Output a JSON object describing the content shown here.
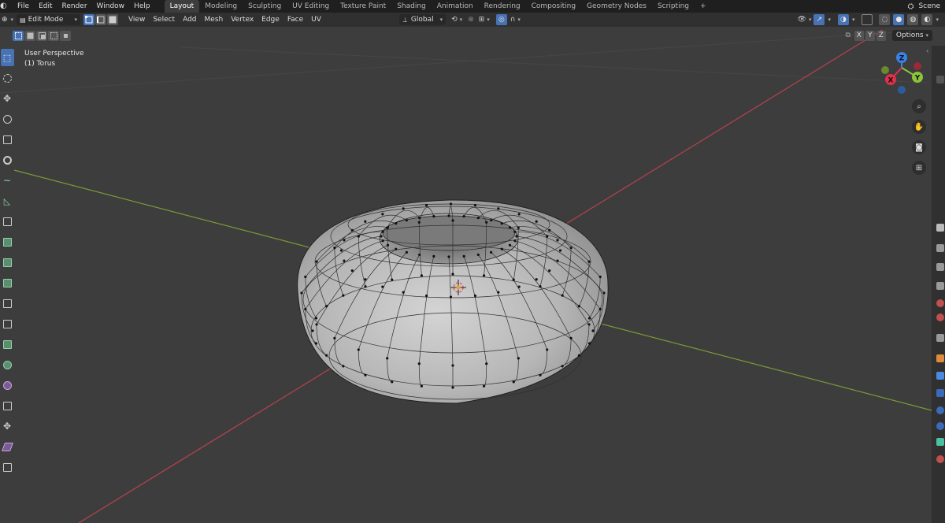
{
  "topbar": {
    "menus": [
      "File",
      "Edit",
      "Render",
      "Window",
      "Help"
    ],
    "workspaces": [
      "Layout",
      "Modeling",
      "Sculpting",
      "UV Editing",
      "Texture Paint",
      "Shading",
      "Animation",
      "Rendering",
      "Compositing",
      "Geometry Nodes",
      "Scripting"
    ],
    "active_workspace": "Layout",
    "add_tab": "+",
    "scene": "Scene"
  },
  "header": {
    "mode": "Edit Mode",
    "menus": [
      "View",
      "Select",
      "Add",
      "Mesh",
      "Vertex",
      "Edge",
      "Face",
      "UV"
    ],
    "orientation": "Global"
  },
  "row2": {
    "axes": [
      "X",
      "Y",
      "Z"
    ],
    "options": "Options"
  },
  "viewport": {
    "perspective": "User Perspective",
    "object": "(1) Torus"
  },
  "gizmo": {
    "x": "X",
    "y": "Y",
    "z": "Z",
    "x_color": "#e0304b",
    "y_color": "#8bc43a",
    "z_color": "#3a82e6"
  },
  "colors": {
    "accent": "#4772b3",
    "viewport_bg": "#3d3d3d",
    "axis_x": "#c44553",
    "axis_y": "#7ea13a"
  },
  "icons": {
    "nav": [
      "zoom-icon",
      "hand-icon",
      "camera-icon",
      "grid-icon"
    ],
    "tools": [
      "select-box-icon",
      "cursor-icon",
      "move-icon",
      "rotate-icon",
      "scale-icon",
      "transform-icon",
      "annotate-icon",
      "measure-icon",
      "add-cube-icon",
      "extrude-icon",
      "inset-icon",
      "bevel-icon",
      "loop-cut-icon",
      "knife-icon",
      "poly-build-icon",
      "spin-icon",
      "smooth-icon",
      "edge-slide-icon",
      "shrink-fatten-icon",
      "shear-icon",
      "rip-icon"
    ]
  }
}
